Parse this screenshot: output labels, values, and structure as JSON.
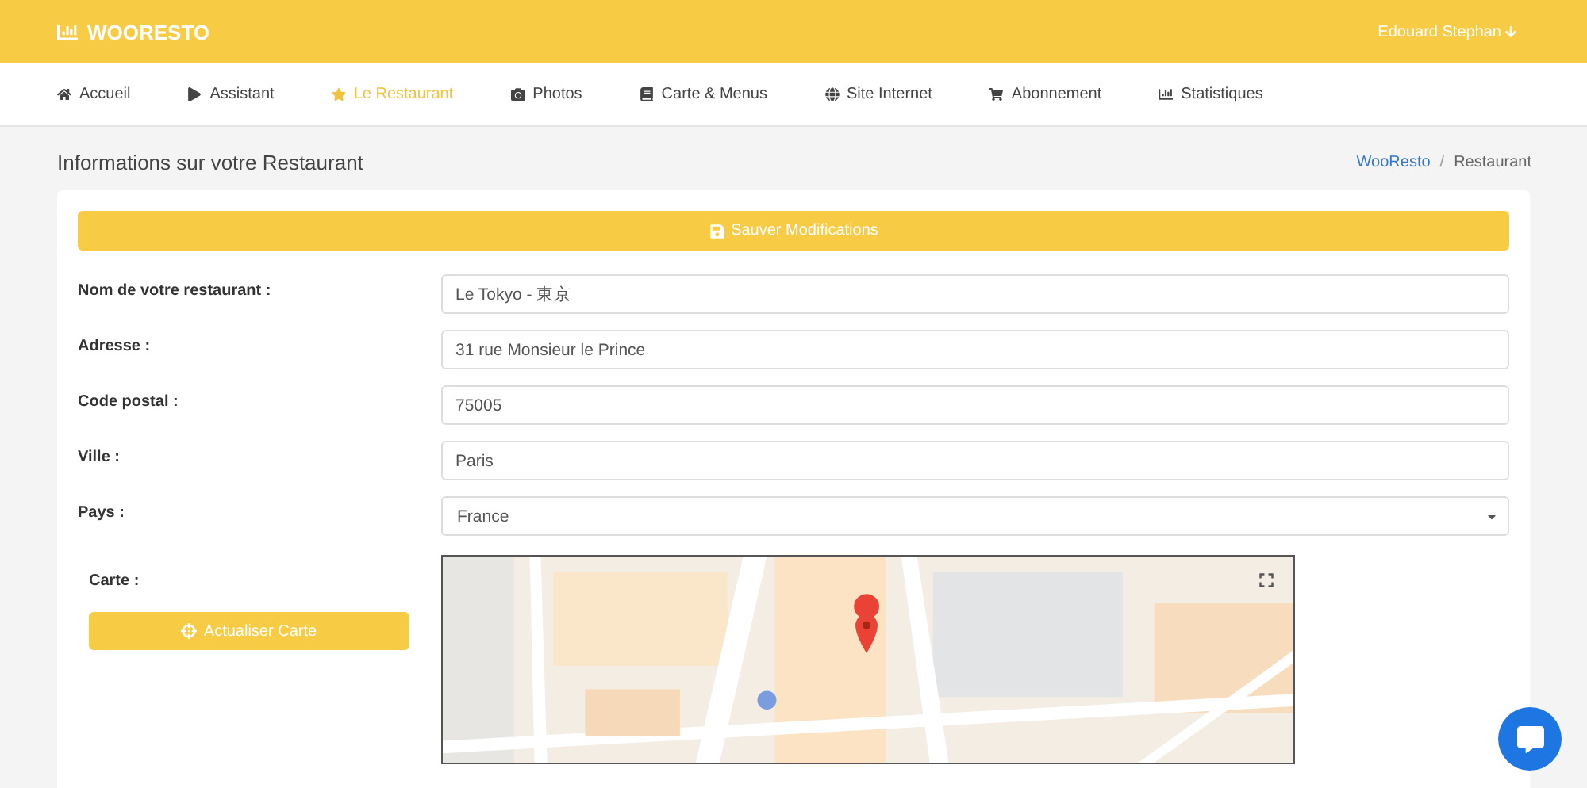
{
  "brand": {
    "name": "WOORESTO"
  },
  "user": {
    "name": "Edouard Stephan"
  },
  "nav": [
    {
      "label": "Accueil",
      "selected": false
    },
    {
      "label": "Assistant",
      "selected": false
    },
    {
      "label": "Le Restaurant",
      "selected": true
    },
    {
      "label": "Photos",
      "selected": false
    },
    {
      "label": "Carte & Menus",
      "selected": false
    },
    {
      "label": "Site Internet",
      "selected": false
    },
    {
      "label": "Abonnement",
      "selected": false
    },
    {
      "label": "Statistiques",
      "selected": false
    }
  ],
  "page": {
    "title": "Informations sur votre Restaurant",
    "breadcrumb_separator": "/",
    "breadcrumb": [
      {
        "label": "WooResto",
        "kind": "link"
      },
      {
        "label": "Restaurant",
        "kind": "current"
      }
    ]
  },
  "form": {
    "save_button": "Sauver Modifications",
    "fields": [
      {
        "label": "Nom de votre restaurant :",
        "value": "Le Tokyo - 東京",
        "kind": "text"
      },
      {
        "label": "Adresse :",
        "value": "31 rue Monsieur le Prince",
        "kind": "text"
      },
      {
        "label": "Code postal :",
        "value": "75005",
        "kind": "text"
      },
      {
        "label": "Ville :",
        "value": "Paris",
        "kind": "text"
      },
      {
        "label": "Pays :",
        "value": "France",
        "kind": "select"
      }
    ],
    "map": {
      "label": "Carte :",
      "button": "Actualiser Carte",
      "kind": "picture"
    }
  }
}
